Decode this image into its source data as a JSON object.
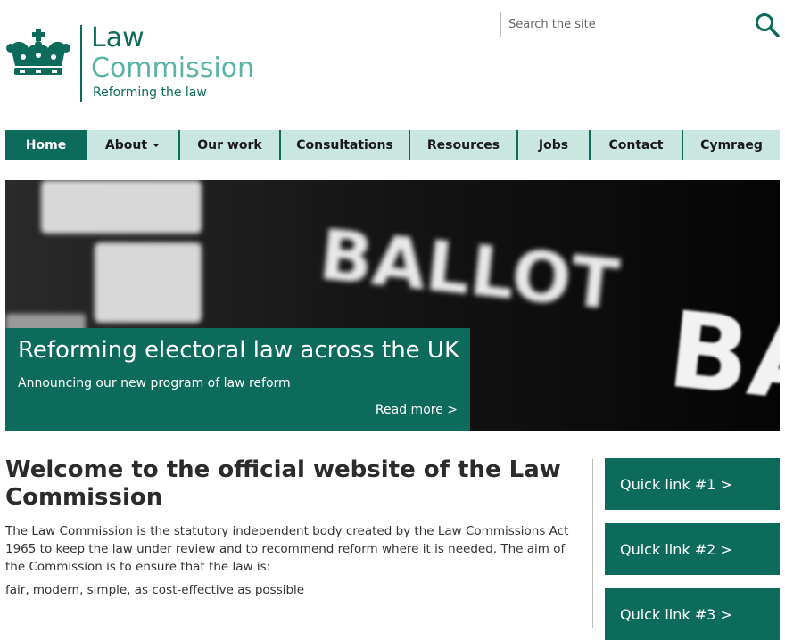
{
  "brand": {
    "line1": "Law",
    "line2": "Commission",
    "tagline": "Reforming the law",
    "primary_color": "#0d6b5c",
    "secondary_color": "#5ab3a4",
    "logo_icon": "crown-icon"
  },
  "search": {
    "placeholder": "Search the site",
    "button_icon": "search-icon"
  },
  "nav": {
    "items": [
      {
        "label": "Home",
        "active": true
      },
      {
        "label": "About",
        "has_dropdown": true
      },
      {
        "label": "Our work"
      },
      {
        "label": "Consultations"
      },
      {
        "label": "Resources"
      },
      {
        "label": "Jobs"
      },
      {
        "label": "Contact"
      },
      {
        "label": "Cymraeg"
      }
    ]
  },
  "hero": {
    "title": "Reforming electoral law across the UK",
    "subtitle": "Announcing our new program of law reform",
    "read_more": "Read more >",
    "image_text": [
      "BALLOT",
      "BA"
    ]
  },
  "main": {
    "heading": "Welcome to the official website of the Law Commission",
    "intro": "The Law Commission is the statutory independent body created by the Law Commissions Act 1965 to keep the law under review and to recommend reform where it is needed. The aim of the Commission is to ensure that the law is:",
    "aims": "fair, modern, simple, as cost-effective as possible"
  },
  "quick_links": [
    {
      "label": "Quick link #1 >"
    },
    {
      "label": "Quick link #2 >"
    },
    {
      "label": "Quick link #3 >"
    }
  ]
}
